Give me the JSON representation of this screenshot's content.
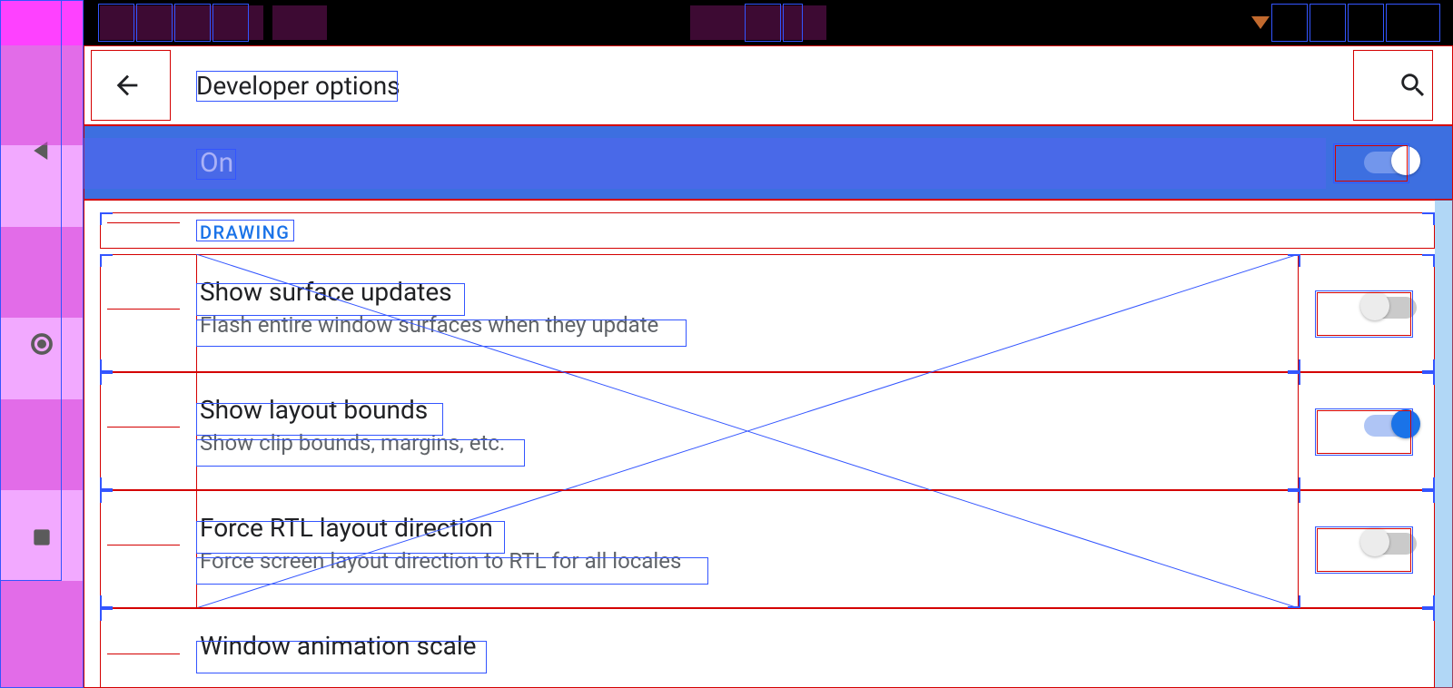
{
  "status_bar": {},
  "nav_rail": {
    "back_icon": "triangle-left",
    "home_icon": "circle",
    "recent_icon": "square"
  },
  "app_bar": {
    "title": "Developer options",
    "back_icon": "arrow-left",
    "search_icon": "magnifier"
  },
  "master_toggle": {
    "label": "On",
    "checked": true
  },
  "sections": [
    {
      "header": "Drawing",
      "items": [
        {
          "title": "Show surface updates",
          "summary": "Flash entire window surfaces when they update",
          "has_switch": true,
          "checked": false
        },
        {
          "title": "Show layout bounds",
          "summary": "Show clip bounds, margins, etc.",
          "has_switch": true,
          "checked": true
        },
        {
          "title": "Force RTL layout direction",
          "summary": "Force screen layout direction to RTL for all locales",
          "has_switch": true,
          "checked": false
        },
        {
          "title": "Window animation scale",
          "summary": "",
          "has_switch": false,
          "checked": false
        }
      ]
    }
  ]
}
